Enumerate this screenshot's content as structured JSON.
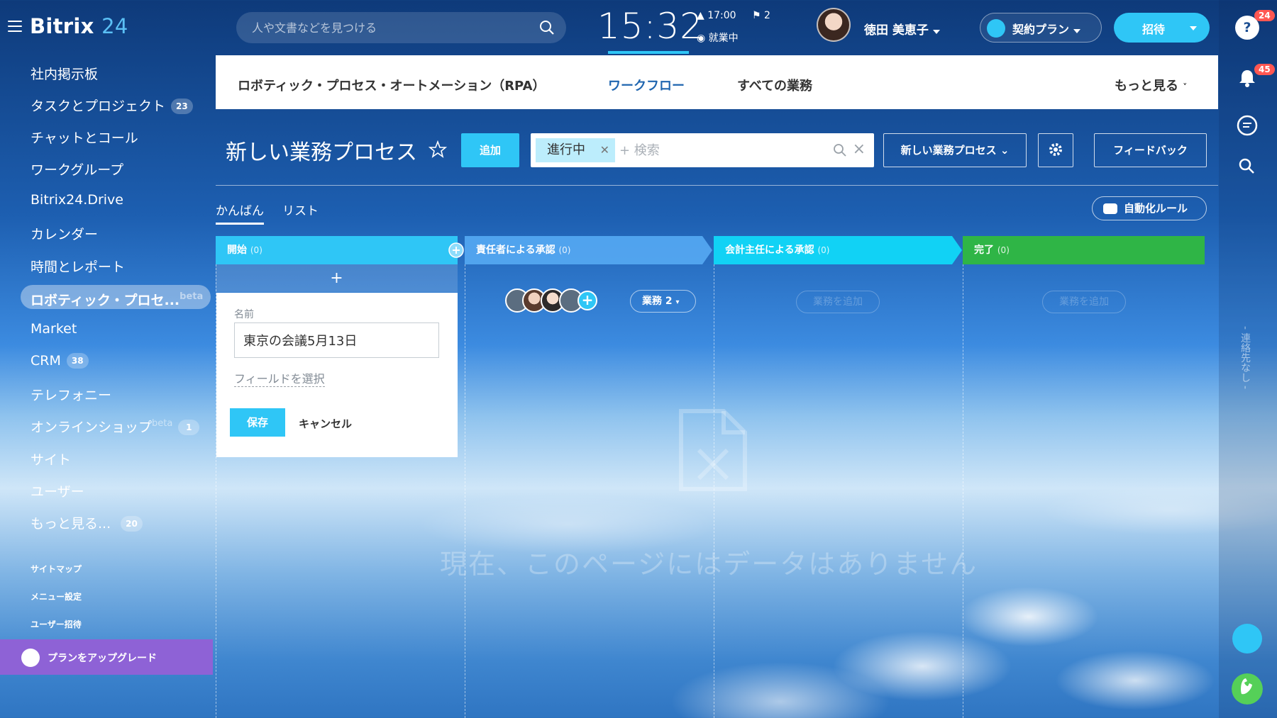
{
  "topbar": {
    "logo_text": "Bitrix",
    "logo_num": "24",
    "search_placeholder": "人や文書などを見つける",
    "clock": "15:32",
    "alarm_time": "17:00",
    "flag_count": "2",
    "work_status": "就業中",
    "user_name": "徳田 美恵子",
    "plan_label": "契約プラン",
    "invite_label": "招待"
  },
  "sidebar": {
    "items": [
      {
        "label": "社内掲示板",
        "badge": ""
      },
      {
        "label": "タスクとプロジェクト",
        "badge": "23"
      },
      {
        "label": "チャットとコール",
        "badge": ""
      },
      {
        "label": "ワークグループ",
        "badge": ""
      },
      {
        "label": "Bitrix24.Drive",
        "badge": ""
      },
      {
        "label": "カレンダー",
        "badge": ""
      },
      {
        "label": "時間とレポート",
        "badge": ""
      },
      {
        "label": "ロボティック・プロセ...",
        "badge": "",
        "beta": "beta"
      },
      {
        "label": "Market",
        "badge": ""
      },
      {
        "label": "CRM",
        "badge": "38"
      },
      {
        "label": "テレフォニー",
        "badge": ""
      },
      {
        "label": "オンラインショップ",
        "badge": "1",
        "beta": "beta"
      },
      {
        "label": "サイト",
        "badge": ""
      },
      {
        "label": "ユーザー",
        "badge": ""
      },
      {
        "label": "もっと見る... ",
        "badge": "20"
      }
    ],
    "small_links": [
      "サイトマップ",
      "メニュー設定",
      "ユーザー招待"
    ],
    "upgrade_label": "プランをアップグレード"
  },
  "rail": {
    "help_badge": "24",
    "notify_badge": "45",
    "vertical_text": "- 連絡先なし -"
  },
  "main_tabs": [
    {
      "label": "ロボティック・プロセス・オートメーション（RPA）"
    },
    {
      "label": "ワークフロー"
    },
    {
      "label": "すべての業務"
    },
    {
      "label": "もっと見る"
    }
  ],
  "toolbar": {
    "title": "新しい業務プロセス",
    "add_label": "追加",
    "filter_chip": "進行中",
    "filter_placeholder": "+ 検索",
    "process_select": "新しい業務プロセス",
    "feedback_label": "フィードバック"
  },
  "views": {
    "kanban": "かんばん",
    "list": "リスト",
    "automation": "自動化ルール"
  },
  "columns": [
    {
      "title": "開始",
      "count": "(0)",
      "color": "#2fc6f6"
    },
    {
      "title": "責任者による承認",
      "count": "(0)",
      "color": "#55a8f2"
    },
    {
      "title": "会計主任による承認",
      "count": "(0)",
      "color": "#11d2f5"
    },
    {
      "title": "完了",
      "count": "(0)",
      "color": "#2fb546"
    }
  ],
  "card": {
    "name_label": "名前",
    "name_value": "東京の会議5月13日",
    "select_fields": "フィールドを選択",
    "save": "保存",
    "cancel": "キャンセル"
  },
  "tasks_pill": "業務  2",
  "ghost_add": "業務を追加",
  "empty_message": "現在、このページにはデータはありません",
  "colors": {
    "accent": "#2fc6f6",
    "upgrade": "#8e62d6",
    "badge_red": "#ff5752",
    "done_green": "#2fb546"
  }
}
